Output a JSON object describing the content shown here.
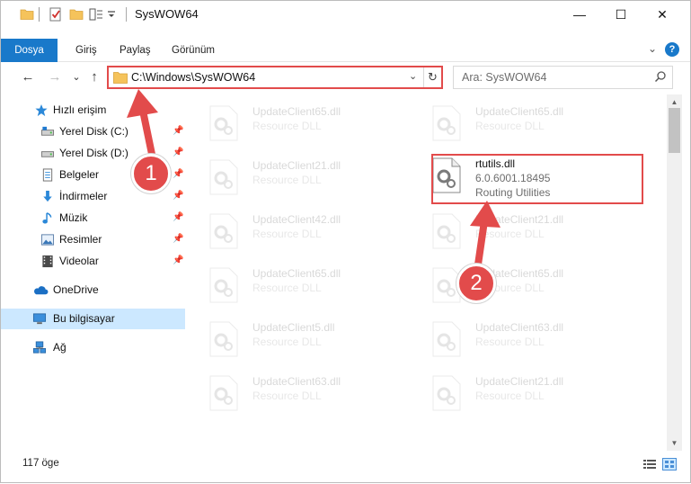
{
  "window": {
    "title": "SysWOW64",
    "minimize_glyph": "—",
    "maximize_glyph": "☐",
    "close_glyph": "✕"
  },
  "ribbon": {
    "tabs": [
      "Dosya",
      "Giriş",
      "Paylaş",
      "Görünüm"
    ],
    "expand_glyph": "⌄",
    "help_glyph": "?"
  },
  "nav": {
    "back_glyph": "←",
    "forward_glyph": "→",
    "recent_glyph": "⌄",
    "up_glyph": "↑",
    "address": "C:\\Windows\\SysWOW64",
    "address_dropdown_glyph": "⌄",
    "refresh_glyph": "↻",
    "search_placeholder": "Ara: SysWOW64"
  },
  "sidebar": {
    "items": [
      {
        "label": "Hızlı erişim",
        "icon": "star-icon"
      },
      {
        "label": "Yerel Disk (C:)",
        "icon": "drive-icon",
        "pinned": true
      },
      {
        "label": "Yerel Disk (D:)",
        "icon": "drive-icon",
        "pinned": true
      },
      {
        "label": "Belgeler",
        "icon": "documents-icon",
        "pinned": true
      },
      {
        "label": "İndirmeler",
        "icon": "downloads-icon",
        "pinned": true
      },
      {
        "label": "Müzik",
        "icon": "music-icon",
        "pinned": true
      },
      {
        "label": "Resimler",
        "icon": "pictures-icon",
        "pinned": true
      },
      {
        "label": "Videolar",
        "icon": "videos-icon",
        "pinned": true
      },
      {
        "label": "OneDrive",
        "icon": "onedrive-icon"
      },
      {
        "label": "Bu bilgisayar",
        "icon": "computer-icon",
        "selected": true
      },
      {
        "label": "Ağ",
        "icon": "network-icon"
      }
    ],
    "pin_glyph": "📌"
  },
  "files": [
    {
      "name": "UpdateClient65.dll",
      "sub": "Resource DLL",
      "faded": true
    },
    {
      "name": "UpdateClient65.dll",
      "sub": "Resource DLL",
      "faded": true
    },
    {
      "name": "UpdateClient21.dll",
      "sub": "Resource DLL",
      "faded": true
    },
    {
      "name": "rtutils.dll",
      "sub": "6.0.6001.18495",
      "sub2": "Routing Utilities",
      "faded": false
    },
    {
      "name": "UpdateClient42.dll",
      "sub": "Resource DLL",
      "faded": true
    },
    {
      "name": "UpdateClient21.dll",
      "sub": "Resource DLL",
      "faded": true
    },
    {
      "name": "UpdateClient65.dll",
      "sub": "Resource DLL",
      "faded": true
    },
    {
      "name": "UpdateClient65.dll",
      "sub": "Resource DLL",
      "faded": true
    },
    {
      "name": "UpdateClient5.dll",
      "sub": "Resource DLL",
      "faded": true
    },
    {
      "name": "UpdateClient63.dll",
      "sub": "Resource DLL",
      "faded": true
    },
    {
      "name": "UpdateClient63.dll",
      "sub": "Resource DLL",
      "faded": true
    },
    {
      "name": "UpdateClient21.dll",
      "sub": "Resource DLL",
      "faded": true
    }
  ],
  "status": {
    "item_count": "117 öge"
  },
  "callouts": [
    {
      "number": "1"
    },
    {
      "number": "2"
    }
  ],
  "colors": {
    "accent": "#1979ca",
    "highlight": "#e24b4b",
    "selected": "#cce8ff"
  }
}
